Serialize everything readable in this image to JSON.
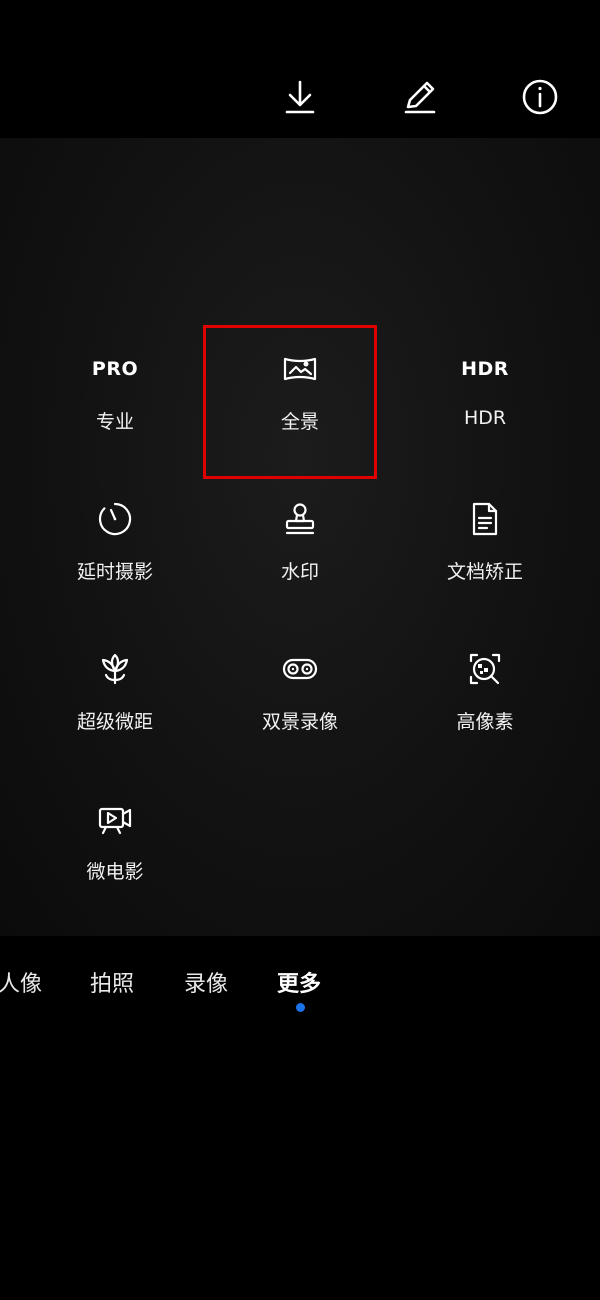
{
  "top_actions": {
    "download_icon": "download-icon",
    "edit_icon": "pencil-icon",
    "info_icon": "info-icon"
  },
  "modes": {
    "pro": {
      "glyph": "PRO",
      "label": "专业"
    },
    "panorama": {
      "icon": "panorama-icon",
      "label": "全景"
    },
    "hdr": {
      "glyph": "HDR",
      "label": "HDR"
    },
    "timelapse": {
      "icon": "timer-icon",
      "label": "延时摄影"
    },
    "watermark": {
      "icon": "stamp-icon",
      "label": "水印"
    },
    "document": {
      "icon": "document-icon",
      "label": "文档矫正"
    },
    "super_macro": {
      "icon": "flower-icon",
      "label": "超级微距"
    },
    "dual_view": {
      "icon": "dual-lens-icon",
      "label": "双景录像"
    },
    "high_res": {
      "icon": "high-res-icon",
      "label": "高像素"
    },
    "micro_movie": {
      "icon": "film-camera-icon",
      "label": "微电影"
    }
  },
  "mode_tabs": [
    {
      "label": "人像"
    },
    {
      "label": "拍照"
    },
    {
      "label": "录像"
    },
    {
      "label": "更多",
      "active": true
    }
  ],
  "colors": {
    "highlight_border": "#e00000",
    "active_indicator": "#1a73e8"
  }
}
